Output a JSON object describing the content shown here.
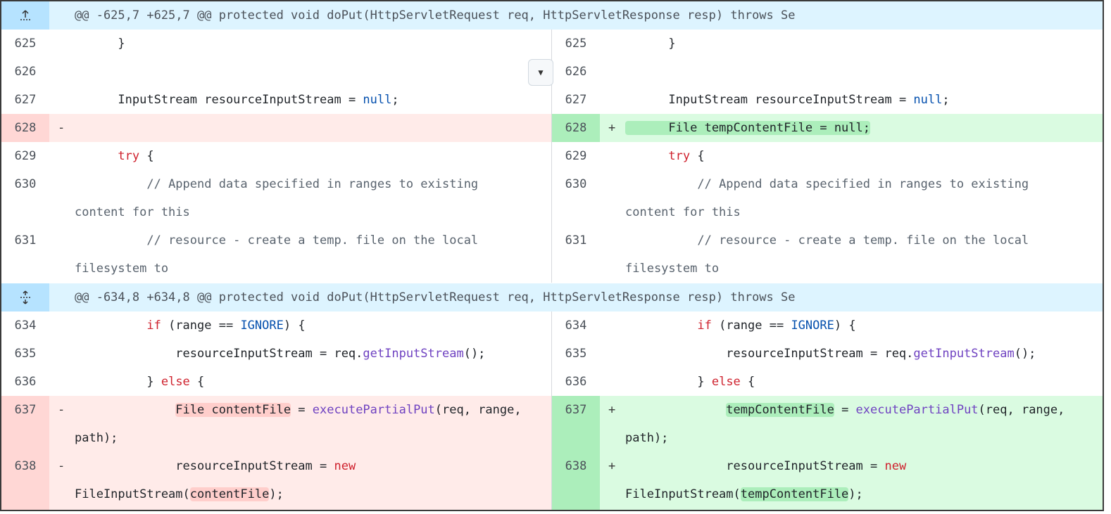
{
  "hunks": [
    {
      "header": "@@ -625,7 +625,7 @@ protected void doPut(HttpServletRequest req, HttpServletResponse resp) throws Se",
      "icon": "fold-up-icon"
    },
    {
      "header": "@@ -634,8 +634,8 @@ protected void doPut(HttpServletRequest req, HttpServletResponse resp) throws Se",
      "icon": "unfold-icon"
    }
  ],
  "lines": {
    "l625": "625",
    "l626": "626",
    "l627": "627",
    "l628": "628",
    "l629": "629",
    "l630": "630",
    "l631": "631",
    "l634": "634",
    "l635": "635",
    "l636": "636",
    "l637": "637",
    "l638": "638"
  },
  "signs": {
    "del": "-",
    "add": "+"
  },
  "code": {
    "brace_close": "}",
    "input_decl": "InputStream resourceInputStream = ",
    "null": "null",
    "semi": ";",
    "file_decl_add": "File tempContentFile = null;",
    "try": "try",
    "brace_open": " {",
    "comment1a": "// Append data specified in ranges to existing",
    "comment1b": "content for this",
    "comment2a": "// resource - create a temp. file on the local",
    "comment2b": "filesystem to",
    "if": "if",
    "range_cond": " (range == ",
    "ignore": "IGNORE",
    "cond_close": ") {",
    "res_assign": "resourceInputStream = req.",
    "get_input": "getInputStream",
    "call_close": "();",
    "else_open": "} ",
    "else": "else",
    "del_file_decl": "File contentFile",
    "add_temp_file": "tempContentFile",
    "assign_eq": " = ",
    "exec_partial": "executePartialPut",
    "exec_args": "(req, range,",
    "path_close": "path);",
    "res_assign_new": "resourceInputStream = ",
    "new": "new",
    "fis_open": "FileInputStream(",
    "content_file": "contentFile",
    "temp_content_file": "tempContentFile",
    "paren_semi": ");"
  },
  "scroll_button_icon": "chevron-down-icon"
}
